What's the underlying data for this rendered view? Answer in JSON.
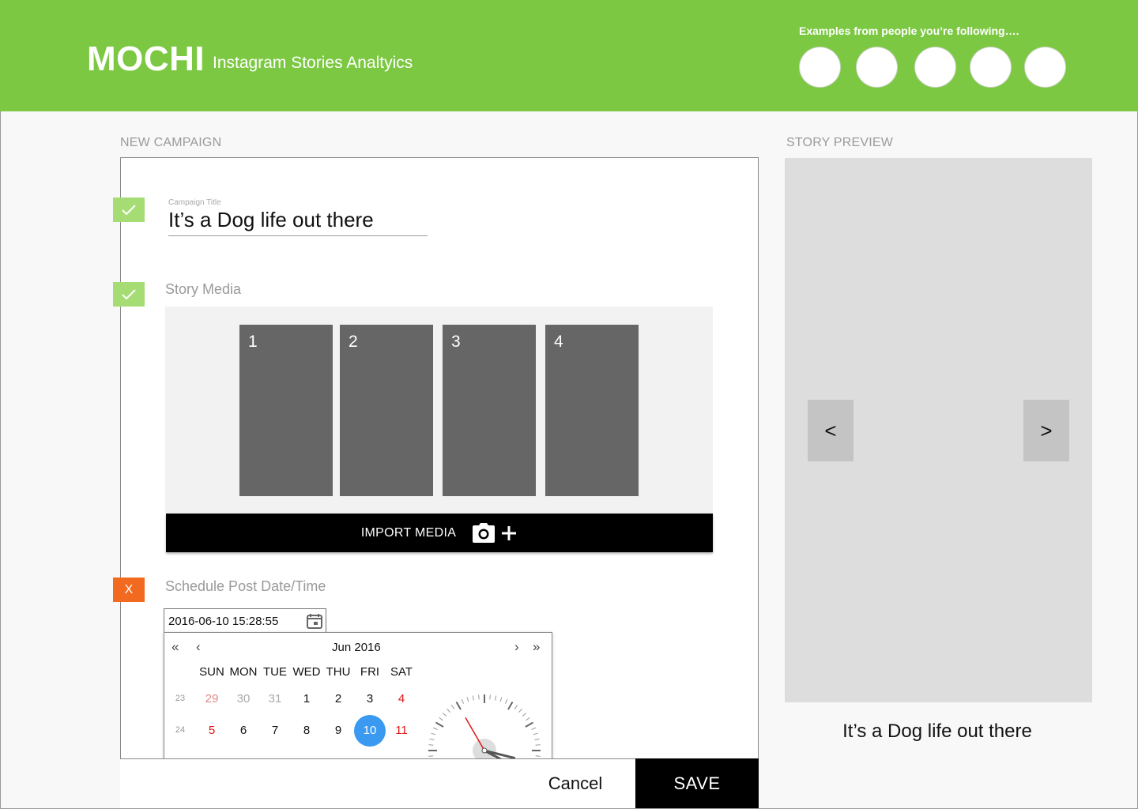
{
  "header": {
    "logo": "MOCHI",
    "subtitle": "Instagram Stories Analtyics",
    "examples_label": "Examples from people you’re following….",
    "avatar_count": 5
  },
  "form": {
    "section_label": "NEW CAMPAIGN",
    "campaign_title": {
      "label": "Campaign Title",
      "value": "It’s a Dog life out there",
      "status": "complete"
    },
    "story_media": {
      "label": "Story Media",
      "status": "complete",
      "slots": [
        "1",
        "2",
        "3",
        "4"
      ],
      "import_label": "IMPORT MEDIA"
    },
    "schedule": {
      "label": "Schedule Post Date/Time",
      "status": "error",
      "status_text": "X",
      "datetime_value": "2016-06-10 15:28:55"
    }
  },
  "datepicker": {
    "nav_prev_year": "«",
    "nav_prev_month": "‹",
    "nav_next_month": "›",
    "nav_next_year": "»",
    "month_label": "Jun 2016",
    "weekdays": [
      "SUN",
      "MON",
      "TUE",
      "WED",
      "THU",
      "FRI",
      "SAT"
    ],
    "weeks": [
      {
        "week": "23",
        "days": [
          "29",
          "30",
          "31",
          "1",
          "2",
          "3",
          "4"
        ]
      },
      {
        "week": "24",
        "days": [
          "5",
          "6",
          "7",
          "8",
          "9",
          "10",
          "11"
        ]
      }
    ],
    "selected_day": "10",
    "selected_color": "#3a99f0",
    "weekend_color": "#e01515"
  },
  "actions": {
    "cancel_label": "Cancel",
    "save_label": "SAVE"
  },
  "preview": {
    "section_label": "STORY PREVIEW",
    "prev_label": "<",
    "next_label": ">",
    "caption": "It’s a Dog life out there"
  },
  "colors": {
    "brand_green": "#7cc843",
    "status_ok": "#a5dc74",
    "status_error": "#f26a1f"
  }
}
